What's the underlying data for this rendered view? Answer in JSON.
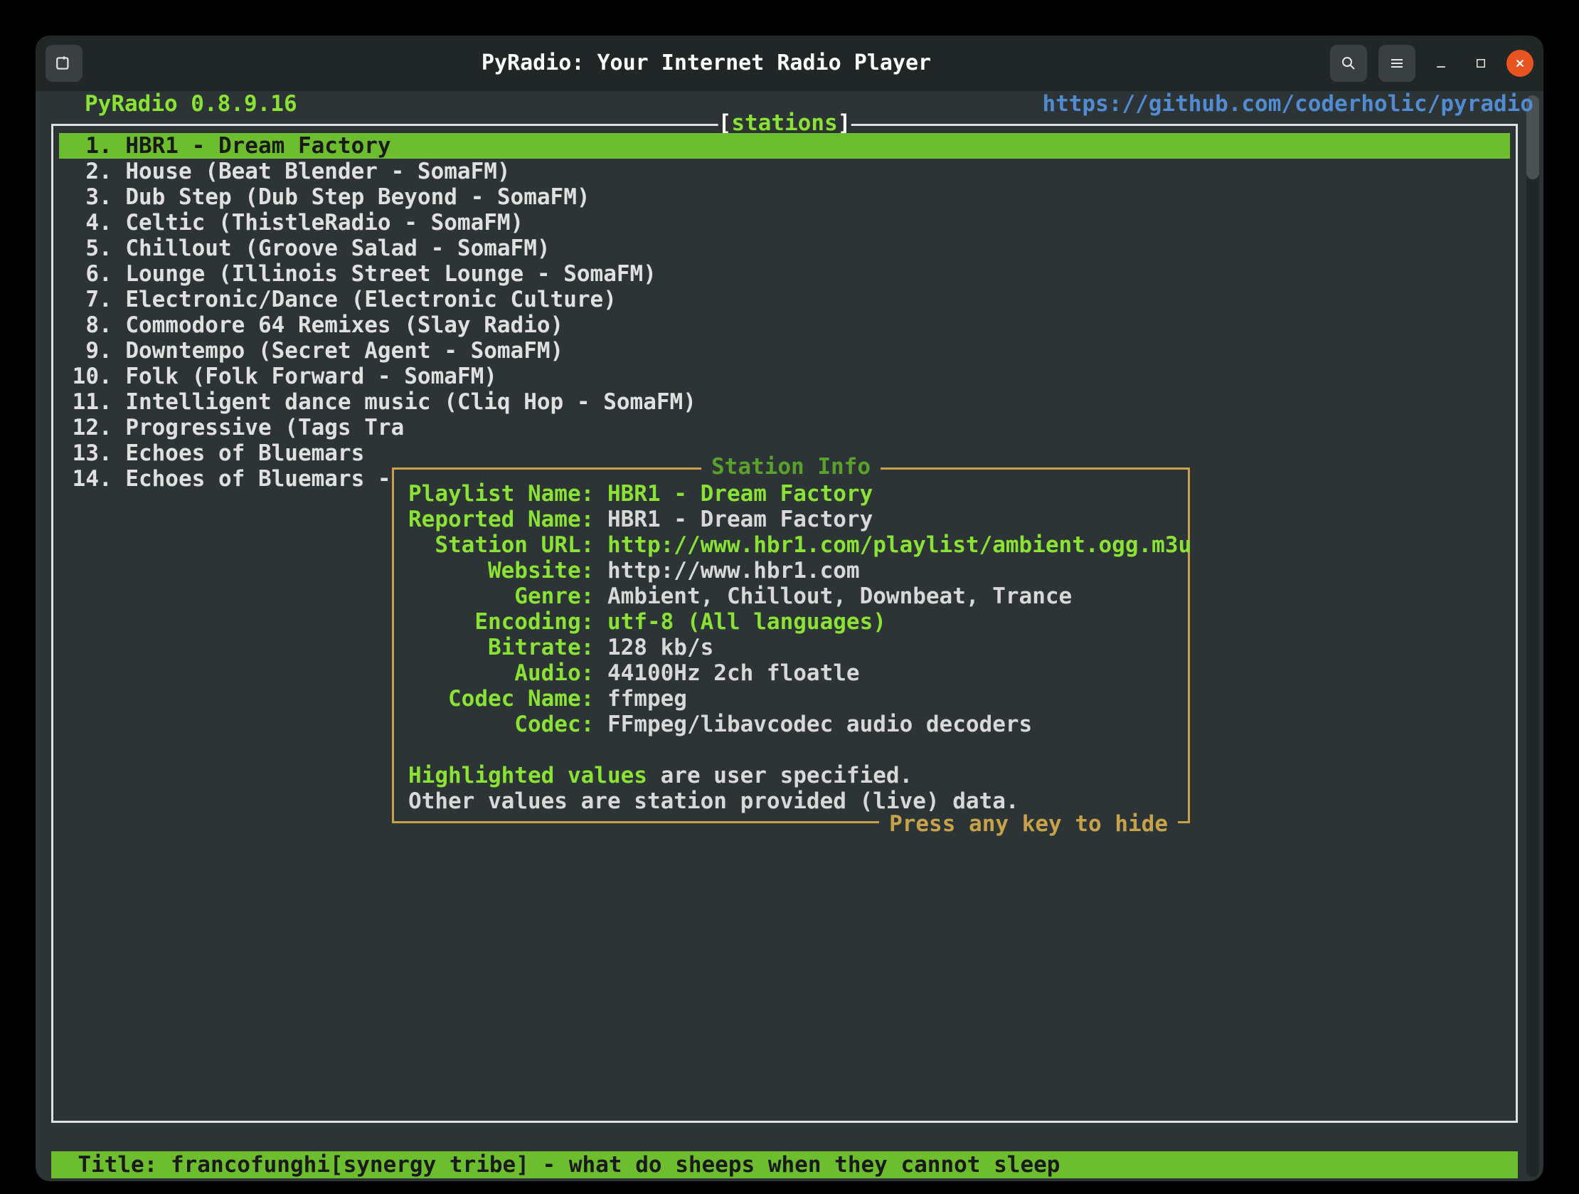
{
  "window": {
    "title": "PyRadio: Your Internet Radio Player"
  },
  "header": {
    "app": "PyRadio 0.8.9.16",
    "url": "https://github.com/coderholic/pyradio"
  },
  "frame_label": {
    "lb": "[",
    "txt": "stations",
    "rb": "]"
  },
  "stations": [
    {
      "n": " 1",
      "name": "HBR1 - Dream Factory",
      "sel": true
    },
    {
      "n": " 2",
      "name": "House (Beat Blender - SomaFM)"
    },
    {
      "n": " 3",
      "name": "Dub Step (Dub Step Beyond - SomaFM)"
    },
    {
      "n": " 4",
      "name": "Celtic (ThistleRadio - SomaFM)"
    },
    {
      "n": " 5",
      "name": "Chillout (Groove Salad - SomaFM)"
    },
    {
      "n": " 6",
      "name": "Lounge (Illinois Street Lounge - SomaFM)"
    },
    {
      "n": " 7",
      "name": "Electronic/Dance (Electronic Culture)"
    },
    {
      "n": " 8",
      "name": "Commodore 64 Remixes (Slay Radio)"
    },
    {
      "n": " 9",
      "name": "Downtempo (Secret Agent - SomaFM)"
    },
    {
      "n": "10",
      "name": "Folk (Folk Forward - SomaFM)"
    },
    {
      "n": "11",
      "name": "Intelligent dance music (Cliq Hop - SomaFM)"
    },
    {
      "n": "12",
      "name": "Progressive (Tags Tra"
    },
    {
      "n": "13",
      "name": "Echoes of Bluemars"
    },
    {
      "n": "14",
      "name": "Echoes of Bluemars -"
    }
  ],
  "info": {
    "title": "Station Info",
    "rows": [
      {
        "k": "Playlist Name:",
        "v": "HBR1 - Dream Factory",
        "pad": 0,
        "hl": true
      },
      {
        "k": "Reported Name:",
        "v": "HBR1 - Dream Factory",
        "pad": 0,
        "hl": false
      },
      {
        "k": "Station URL:",
        "v": "http://www.hbr1.com/playlist/ambient.ogg.m3u",
        "pad": 2,
        "hl": true
      },
      {
        "k": "Website:",
        "v": "http://www.hbr1.com",
        "pad": 6,
        "hl": false
      },
      {
        "k": "Genre:",
        "v": "Ambient, Chillout, Downbeat, Trance",
        "pad": 8,
        "hl": false
      },
      {
        "k": "Encoding:",
        "v": "utf-8 (All languages)",
        "pad": 5,
        "hl": true
      },
      {
        "k": "Bitrate:",
        "v": "128 kb/s",
        "pad": 6,
        "hl": false
      },
      {
        "k": "Audio:",
        "v": "44100Hz 2ch floatle",
        "pad": 8,
        "hl": false
      },
      {
        "k": "Codec Name:",
        "v": "ffmpeg",
        "pad": 3,
        "hl": false
      },
      {
        "k": "Codec:",
        "v": "FFmpeg/libavcodec audio decoders",
        "pad": 8,
        "hl": false
      }
    ],
    "note_hl": "Highlighted values",
    "note_rest": " are user specified.",
    "note_line2": "Other values are station provided (live) data.",
    "footer": "Press any key to hide"
  },
  "status": "  Title: francofunghi[synergy tribe] - what do sheeps when they cannot sleep"
}
